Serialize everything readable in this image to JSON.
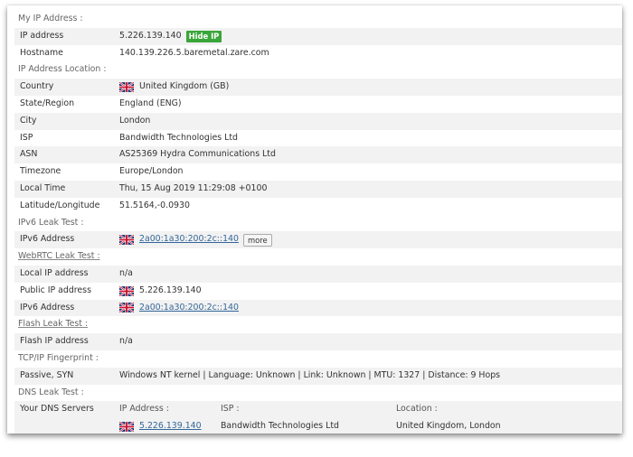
{
  "sections": {
    "my_ip": "My IP Address :",
    "location": "IP Address Location :",
    "ipv6": "IPv6 Leak Test :",
    "webrtc": "WebRTC Leak Test :",
    "flash": "Flash Leak Test :",
    "tcpip": "TCP/IP Fingerprint :",
    "dns": "DNS Leak Test :"
  },
  "ip_address": {
    "label": "IP address",
    "value": "5.226.139.140",
    "hide_button": "Hide IP"
  },
  "hostname": {
    "label": "Hostname",
    "value": "140.139.226.5.baremetal.zare.com"
  },
  "country": {
    "label": "Country",
    "value": "United Kingdom (GB)"
  },
  "state": {
    "label": "State/Region",
    "value": "England (ENG)"
  },
  "city": {
    "label": "City",
    "value": "London"
  },
  "isp": {
    "label": "ISP",
    "value": "Bandwidth Technologies Ltd"
  },
  "asn": {
    "label": "ASN",
    "value": "AS25369 Hydra Communications Ltd"
  },
  "timezone": {
    "label": "Timezone",
    "value": "Europe/London"
  },
  "local_time": {
    "label": "Local Time",
    "value": "Thu, 15 Aug 2019 11:29:08 +0100"
  },
  "latlong": {
    "label": "Latitude/Longitude",
    "value": "51.5164,-0.0930"
  },
  "ipv6_leak": {
    "label": "IPv6 Address",
    "value": "2a00:1a30:200:2c::140",
    "more_button": "more"
  },
  "webrtc_local": {
    "label": "Local IP address",
    "value": "n/a"
  },
  "webrtc_public": {
    "label": "Public IP address",
    "value": "5.226.139.140"
  },
  "webrtc_ipv6": {
    "label": "IPv6 Address",
    "value": "2a00:1a30:200:2c::140"
  },
  "flash_ip": {
    "label": "Flash IP address",
    "value": "n/a"
  },
  "tcpip": {
    "label": "Passive, SYN",
    "value": "Windows NT kernel | Language: Unknown | Link: Unknown | MTU: 1327 | Distance: 9 Hops"
  },
  "dns": {
    "label": "Your DNS Servers",
    "headers": {
      "ip": "IP Address :",
      "isp": "ISP :",
      "location": "Location :"
    },
    "rows": [
      {
        "ip": "5.226.139.140",
        "isp": "Bandwidth Technologies Ltd",
        "location": "United Kingdom, London"
      }
    ]
  },
  "colors": {
    "shade": "#f2f2f2",
    "badge": "#3aa63a",
    "link": "#336699"
  },
  "icons": {
    "flag": "uk-flag-icon"
  }
}
